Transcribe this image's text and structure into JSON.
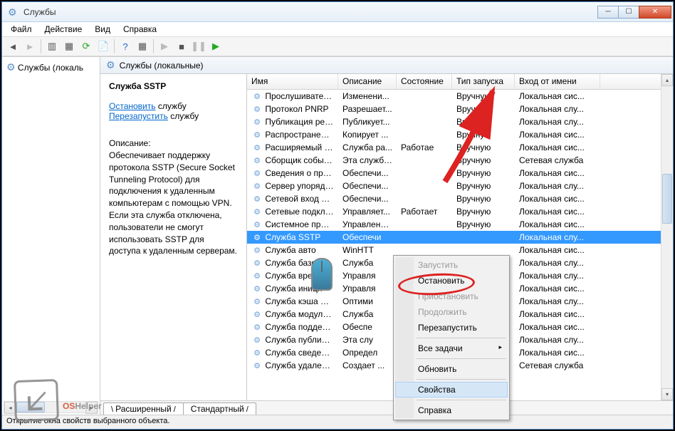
{
  "window": {
    "title": "Службы"
  },
  "menu": {
    "file": "Файл",
    "action": "Действие",
    "view": "Вид",
    "help": "Справка"
  },
  "tree": {
    "root": "Службы (локаль"
  },
  "panel": {
    "header": "Службы (локальные)"
  },
  "detail": {
    "title": "Служба SSTP",
    "stop_label": "Остановить",
    "stop_after": " службу",
    "restart_label": "Перезапустить",
    "restart_after": " службу",
    "desc_label": "Описание:",
    "desc_text": "Обеспечивает поддержку протокола SSTP (Secure Socket Tunneling Protocol) для подключения к удаленным компьютерам с помощью VPN. Если эта служба отключена, пользователи не смогут использовать SSTP для доступа к удаленным серверам."
  },
  "columns": {
    "name": "Имя",
    "desc": "Описание",
    "state": "Состояние",
    "startup": "Тип запуска",
    "logon": "Вход от имени"
  },
  "services": [
    {
      "name": "Прослушиватель...",
      "desc": "Изменени...",
      "state": "",
      "start": "Вручную",
      "logon": "Локальная сис..."
    },
    {
      "name": "Протокол PNRP",
      "desc": "Разрешает...",
      "state": "",
      "start": "Вручную",
      "logon": "Локальная слу..."
    },
    {
      "name": "Публикация ресу...",
      "desc": "Публикует...",
      "state": "",
      "start": "Вручную",
      "logon": "Локальная слу..."
    },
    {
      "name": "Распространение...",
      "desc": "Копирует ...",
      "state": "",
      "start": "Вручную",
      "logon": "Локальная сис..."
    },
    {
      "name": "Расширяемый пр...",
      "desc": "Служба ра...",
      "state": "Работае",
      "start": "Вручную",
      "logon": "Локальная сис..."
    },
    {
      "name": "Сборщик событи...",
      "desc": "Эта служба...",
      "state": "",
      "start": "Вручную",
      "logon": "Сетевая служба"
    },
    {
      "name": "Сведения о прил...",
      "desc": "Обеспечи...",
      "state": "",
      "start": "Вручную",
      "logon": "Локальная сис..."
    },
    {
      "name": "Сервер упорядоч...",
      "desc": "Обеспечи...",
      "state": "",
      "start": "Вручную",
      "logon": "Локальная слу..."
    },
    {
      "name": "Сетевой вход в си...",
      "desc": "Обеспечи...",
      "state": "",
      "start": "Вручную",
      "logon": "Локальная сис..."
    },
    {
      "name": "Сетевые подклю...",
      "desc": "Управляет...",
      "state": "Работает",
      "start": "Вручную",
      "logon": "Локальная сис..."
    },
    {
      "name": "Системное прил...",
      "desc": "Управлени...",
      "state": "",
      "start": "Вручную",
      "logon": "Локальная сис..."
    },
    {
      "name": "Служба SSTP",
      "desc": "Обеспечи",
      "state": "",
      "start": "",
      "logon": "Локальная слу...",
      "selected": true
    },
    {
      "name": "Служба авто",
      "desc": "WinHTT",
      "state": "",
      "start": "",
      "logon": "Локальная сис..."
    },
    {
      "name": "Служба базо",
      "desc": "Служба",
      "state": "",
      "start": "",
      "logon": "Локальная слу..."
    },
    {
      "name": "Служба врем",
      "desc": "Управля",
      "state": "",
      "start": "",
      "logon": "Локальная слу..."
    },
    {
      "name": "Служба иници",
      "desc": "Управля",
      "state": "",
      "start": "",
      "logon": "Локальная сис..."
    },
    {
      "name": "Служба кэша шр...",
      "desc": "Оптими",
      "state": "",
      "start": "",
      "logon": "Локальная слу..."
    },
    {
      "name": "Служба модуля а...",
      "desc": "Служба",
      "state": "",
      "start": "",
      "logon": "Локальная сис..."
    },
    {
      "name": "Служба поддерж...",
      "desc": "Обеспе",
      "state": "",
      "start": "",
      "logon": "Локальная сис..."
    },
    {
      "name": "Служба публика...",
      "desc": "Эта слу",
      "state": "",
      "start": "",
      "logon": "Локальная слу..."
    },
    {
      "name": "Служба сведений...",
      "desc": "Определ",
      "state": "",
      "start": "",
      "logon": "Локальная сис..."
    },
    {
      "name": "Служба удаленн...",
      "desc": "Создает ...",
      "state": "",
      "start": "",
      "logon": "Сетевая служба"
    }
  ],
  "context_menu": {
    "start": "Запустить",
    "stop": "Остановить",
    "pause": "Приостановить",
    "resume": "Продолжить",
    "restart": "Перезапустить",
    "all_tasks": "Все задачи",
    "refresh": "Обновить",
    "properties": "Свойства",
    "help": "Справка"
  },
  "tabs": {
    "extended": "Расширенный",
    "standard": "Стандартный"
  },
  "statusbar": "Открытие окна свойств выбранного объекта.",
  "logo": {
    "os": "OS",
    "helper": "Helper"
  }
}
